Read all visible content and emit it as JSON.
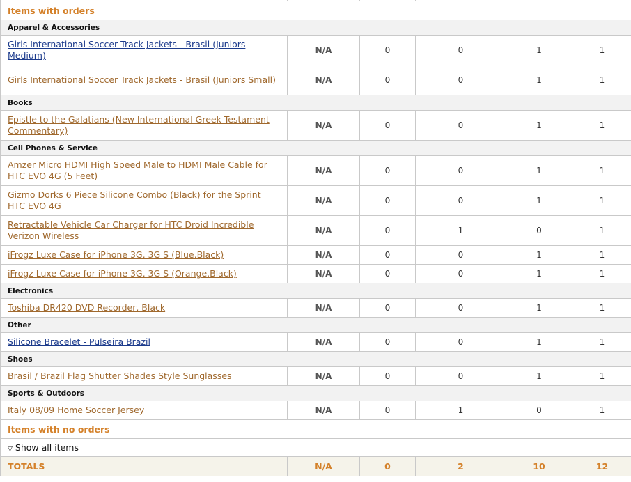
{
  "sections": {
    "with_orders": "Items with orders",
    "no_orders": "Items with no orders"
  },
  "show_all": "Show all items",
  "groups": [
    {
      "category": "Apparel & Accessories",
      "items": [
        {
          "name": "Girls International Soccer Track Jackets - Brasil (Juniors Medium)",
          "visited": false,
          "values": [
            "N/A",
            "0",
            "0",
            "1",
            "1"
          ]
        },
        {
          "name": "Girls International Soccer Track Jackets - Brasil (Juniors Small)",
          "visited": true,
          "values": [
            "N/A",
            "0",
            "0",
            "1",
            "1"
          ]
        }
      ]
    },
    {
      "category": "Books",
      "items": [
        {
          "name": "Epistle to the Galatians (New International Greek Testament Commentary)",
          "visited": true,
          "values": [
            "N/A",
            "0",
            "0",
            "1",
            "1"
          ]
        }
      ]
    },
    {
      "category": "Cell Phones & Service",
      "items": [
        {
          "name": "Amzer Micro HDMI High Speed Male to HDMI Male Cable for HTC EVO 4G (5 Feet)",
          "visited": true,
          "values": [
            "N/A",
            "0",
            "0",
            "1",
            "1"
          ]
        },
        {
          "name": "Gizmo Dorks 6 Piece Silicone Combo (Black) for the Sprint HTC EVO 4G",
          "visited": true,
          "values": [
            "N/A",
            "0",
            "0",
            "1",
            "1"
          ]
        },
        {
          "name": "Retractable Vehicle Car Charger for HTC Droid Incredible Verizon Wireless",
          "visited": true,
          "values": [
            "N/A",
            "0",
            "1",
            "0",
            "1"
          ]
        },
        {
          "name": "iFrogz Luxe Case for iPhone 3G, 3G S (Blue,Black)",
          "visited": true,
          "values": [
            "N/A",
            "0",
            "0",
            "1",
            "1"
          ]
        },
        {
          "name": "iFrogz Luxe Case for iPhone 3G, 3G S (Orange,Black)",
          "visited": true,
          "values": [
            "N/A",
            "0",
            "0",
            "1",
            "1"
          ]
        }
      ]
    },
    {
      "category": "Electronics",
      "items": [
        {
          "name": "Toshiba DR420 DVD Recorder, Black",
          "visited": true,
          "values": [
            "N/A",
            "0",
            "0",
            "1",
            "1"
          ]
        }
      ]
    },
    {
      "category": "Other",
      "items": [
        {
          "name": "Silicone Bracelet - Pulseira Brazil",
          "visited": false,
          "values": [
            "N/A",
            "0",
            "0",
            "1",
            "1"
          ]
        }
      ]
    },
    {
      "category": "Shoes",
      "items": [
        {
          "name": "Brasil / Brazil Flag Shutter Shades Style Sunglasses",
          "visited": true,
          "values": [
            "N/A",
            "0",
            "0",
            "1",
            "1"
          ]
        }
      ]
    },
    {
      "category": "Sports & Outdoors",
      "items": [
        {
          "name": "Italy 08/09 Home Soccer Jersey",
          "visited": true,
          "values": [
            "N/A",
            "0",
            "1",
            "0",
            "1"
          ]
        }
      ]
    }
  ],
  "totals": {
    "label": "TOTALS",
    "values": [
      "N/A",
      "0",
      "2",
      "10",
      "12"
    ]
  },
  "colors": {
    "accent": "#d4812a",
    "link": "#a0692e",
    "link_unvisited": "#1c3b8c"
  }
}
